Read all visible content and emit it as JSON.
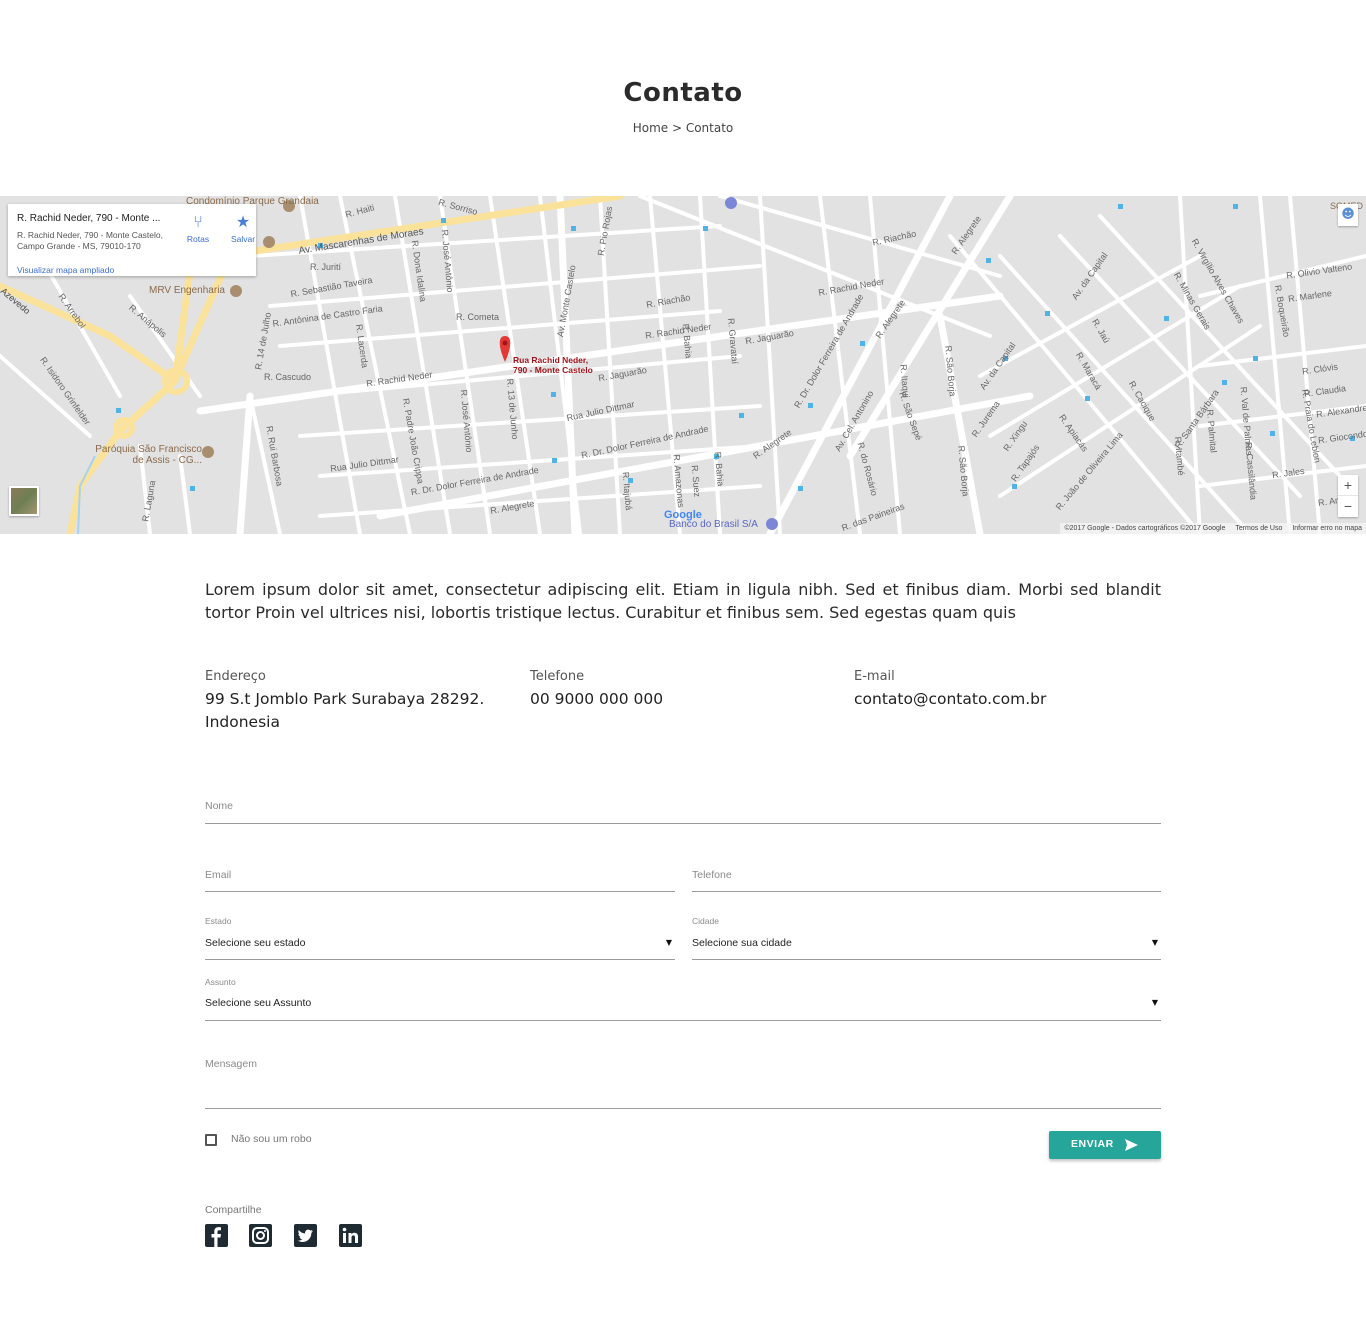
{
  "header": {
    "title": "Contato",
    "breadcrumb": "Home > Contato"
  },
  "map": {
    "card": {
      "place_name": "R. Rachid Neder, 790 - Monte ...",
      "address": "R. Rachid Neder, 790 - Monte Castelo, Campo Grande - MS, 79010-170",
      "directions_label": "Rotas",
      "save_label": "Salvar",
      "enlarge_link": "Visualizar mapa ampliado"
    },
    "pin_label": "Rua Rachid Neder,\n790 - Monte Castelo",
    "street_labels": [
      "Av. Mascarenhas de Moraes",
      "R. Rachid Neder",
      "R. Jaguarão",
      "R. Dr. Dolor Ferreira de Andrade",
      "R. Alegrete",
      "Av. da Capital",
      "R. Cascudo",
      "R. Cometa",
      "R. Sebastião Taveira",
      "R. Antônina de Castro Faria",
      "Rua Julio Dittmar",
      "R. Riachão",
      "R. Olivio Valteno",
      "R. Marlene",
      "R. Clóvis",
      "R. Claudia",
      "R. Jales",
      "R. São Borja",
      "R. Jurema",
      "R. Xingu",
      "R. Tapajós",
      "R. Itaqui",
      "R. São Sepé",
      "R. do Rosário",
      "Av. Cel. Antonino",
      "R. 13 de Junho",
      "R. José Antônio",
      "Av. Monte Castelo",
      "R. 14 de Julho",
      "R. Rui Barbosa",
      "R. Padre João Crippa",
      "R. Bahia",
      "R. Gravataí",
      "R. Suez",
      "R. Pio Rojas",
      "R. Jaú",
      "R. Maracá",
      "R. Cacique",
      "R. Santa Bárbara",
      "R. Palmital",
      "R. Val de Palmas",
      "R. Itambé",
      "R. Cassilândia",
      "R. Praia do Leblon",
      "R. Boqueirão",
      "R. Minas Gerais",
      "R. Virgílio Alves Chaves",
      "R. Jurití",
      "R. Dona Idalina",
      "R. Lacerda",
      "R. Isidoro Grinfelder",
      "R. Arrebol",
      "R. Anápolis",
      "R. Haiti",
      "R. Sorriso",
      "R. Laguna",
      "Azevedo",
      "R. das Paineiras",
      "R. João de Oliveira Lima",
      "R. Apiacás",
      "R. Alexandre",
      "R. Giocondo",
      "R. Ama",
      "R. Itajubá",
      "R. Amazonas"
    ],
    "poi_labels": [
      "Condomínio Parque Grandaia",
      "MRV Engenharia",
      "Paróquia São Francisco de Assis - CG...",
      "Banco do Brasil S/A",
      "SOMED"
    ],
    "google_logo": "Google",
    "footer": {
      "copyright": "©2017 Google - Dados cartográficos ©2017 Google",
      "terms": "Termos de Uso",
      "report": "Informar erro no mapa"
    },
    "zoom_in": "+",
    "zoom_out": "−"
  },
  "intro_text": "Lorem ipsum dolor sit amet, consectetur adipiscing elit. Etiam in ligula nibh. Sed et finibus diam. Morbi sed blandit tortor Proin vel ultrices nisi, lobortis tristique lectus. Curabitur et finibus sem. Sed egestas quam quis",
  "contact_info": {
    "address_label": "Endereço",
    "address_value": "99 S.t Jomblo Park Surabaya 28292. Indonesia",
    "phone_label": "Telefone",
    "phone_value": "00 9000 000 000",
    "email_label": "E-mail",
    "email_value": "contato@contato.com.br"
  },
  "form": {
    "name_placeholder": "Nome",
    "email_placeholder": "Email",
    "phone_placeholder": "Telefone",
    "state_label": "Estado",
    "state_value": "Selecione seu estado",
    "city_label": "Cidade",
    "city_value": "Selecione sua cidade",
    "subject_label": "Assunto",
    "subject_value": "Selecione seu Assunto",
    "message_placeholder": "Mensagem",
    "captcha_label": "Não sou um robo",
    "submit_label": "ENVIAR"
  },
  "share": {
    "label": "Compartilhe",
    "networks": [
      "facebook-icon",
      "instagram-icon",
      "twitter-icon",
      "linkedin-icon"
    ]
  },
  "colors": {
    "accent": "#26a69a",
    "map_bg": "#e2e2e2",
    "main_road": "#fbe29b",
    "pin": "#e53935",
    "social_bg": "#1f2b33"
  }
}
